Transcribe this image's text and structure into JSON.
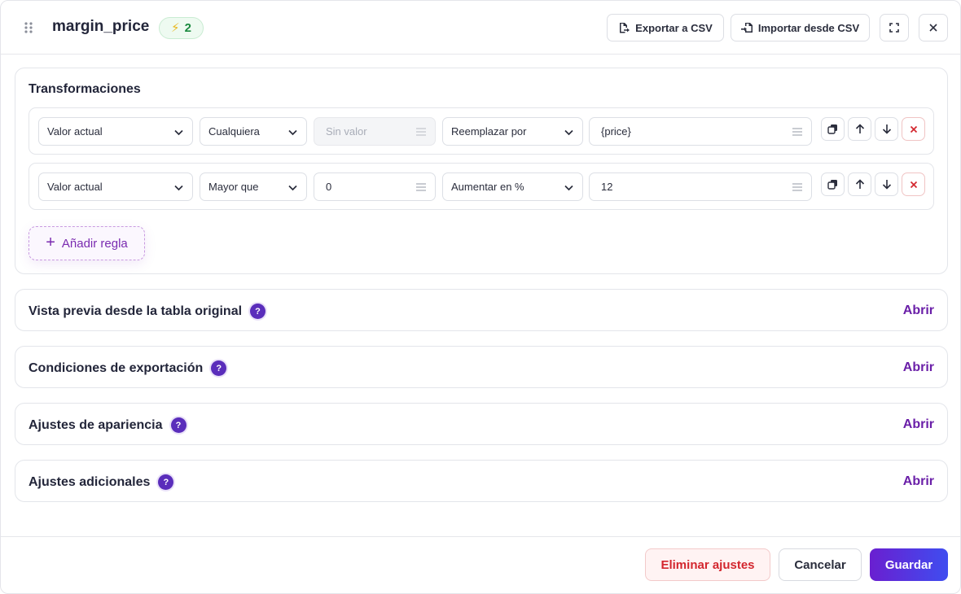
{
  "header": {
    "title": "margin_price",
    "badge_count": "2",
    "export_label": "Exportar a CSV",
    "import_label": "Importar desde CSV"
  },
  "transformations": {
    "title": "Transformaciones",
    "rules": [
      {
        "field": "Valor actual",
        "condition": "Cualquiera",
        "value": "",
        "value_placeholder": "Sin valor",
        "action": "Reemplazar por",
        "result": "{price}"
      },
      {
        "field": "Valor actual",
        "condition": "Mayor que",
        "value": "0",
        "value_placeholder": "",
        "action": "Aumentar en %",
        "result": "12"
      }
    ],
    "add_rule_label": "Añadir regla"
  },
  "sections": [
    {
      "title": "Vista previa desde la tabla original",
      "action": "Abrir"
    },
    {
      "title": "Condiciones de exportación",
      "action": "Abrir"
    },
    {
      "title": "Ajustes de apariencia",
      "action": "Abrir"
    },
    {
      "title": "Ajustes adicionales",
      "action": "Abrir"
    }
  ],
  "footer": {
    "delete_label": "Eliminar ajustes",
    "cancel_label": "Cancelar",
    "save_label": "Guardar"
  },
  "colors": {
    "accent": "#6a1fa8",
    "primary_gradient_start": "#6a1fd0",
    "primary_gradient_end": "#3f4df0",
    "danger": "#d3262e",
    "success": "#1a8a3f"
  }
}
